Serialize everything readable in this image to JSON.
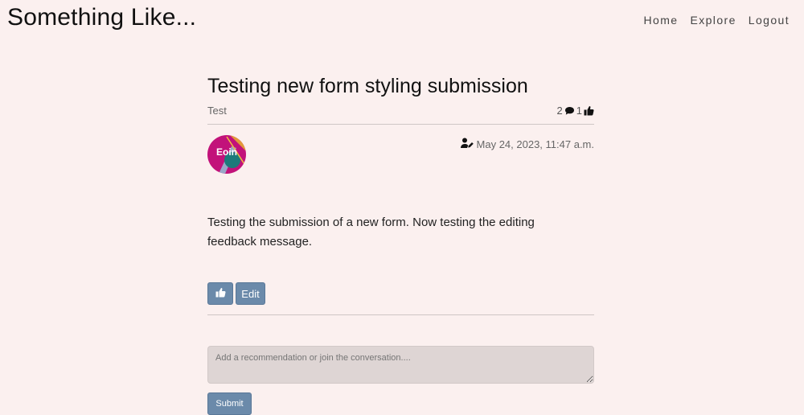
{
  "header": {
    "brand": "Something Like...",
    "nav": [
      "Home",
      "Explore",
      "Logout"
    ]
  },
  "post": {
    "title": "Testing new form styling submission",
    "category": "Test",
    "comment_count": "2",
    "like_count": "1",
    "avatar_label": "Eoin",
    "date": "May 24, 2023, 11:47 a.m.",
    "body": "Testing the submission of a new form. Now testing the editing feedback message."
  },
  "actions": {
    "edit_label": "Edit"
  },
  "comment_form": {
    "placeholder": "Add a recommendation or join the conversation....",
    "submit_label": "Submit"
  },
  "colors": {
    "background": "#fbf0ef",
    "button": "#6b8aaa",
    "input": "#ded5d4"
  }
}
